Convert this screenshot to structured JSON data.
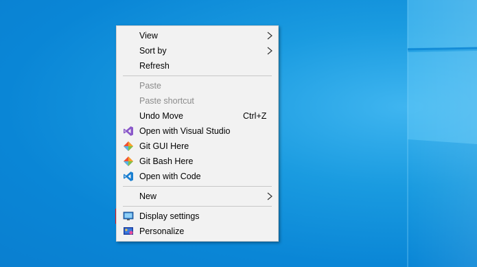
{
  "context_menu": {
    "view": "View",
    "sort_by": "Sort by",
    "refresh": "Refresh",
    "paste": "Paste",
    "paste_shortcut": "Paste shortcut",
    "undo_move": "Undo Move",
    "undo_move_shortcut": "Ctrl+Z",
    "open_visual_studio": "Open with Visual Studio",
    "git_gui": "Git GUI Here",
    "git_bash": "Git Bash Here",
    "open_code": "Open with Code",
    "new": "New",
    "display_settings": "Display settings",
    "personalize": "Personalize"
  },
  "icons": {
    "submenu_arrow": "chevron-right-icon",
    "visual_studio": "visual-studio-icon",
    "git": "git-icon",
    "vscode": "vscode-icon",
    "display": "display-icon",
    "personalize": "personalize-icon"
  },
  "colors": {
    "desktop": "#0a86d6",
    "menu_bg": "#f2f2f2",
    "highlight_border": "#e5141b",
    "visual_studio": "#8a58c9",
    "vscode": "#1a7fd1",
    "git": "#f05033"
  }
}
